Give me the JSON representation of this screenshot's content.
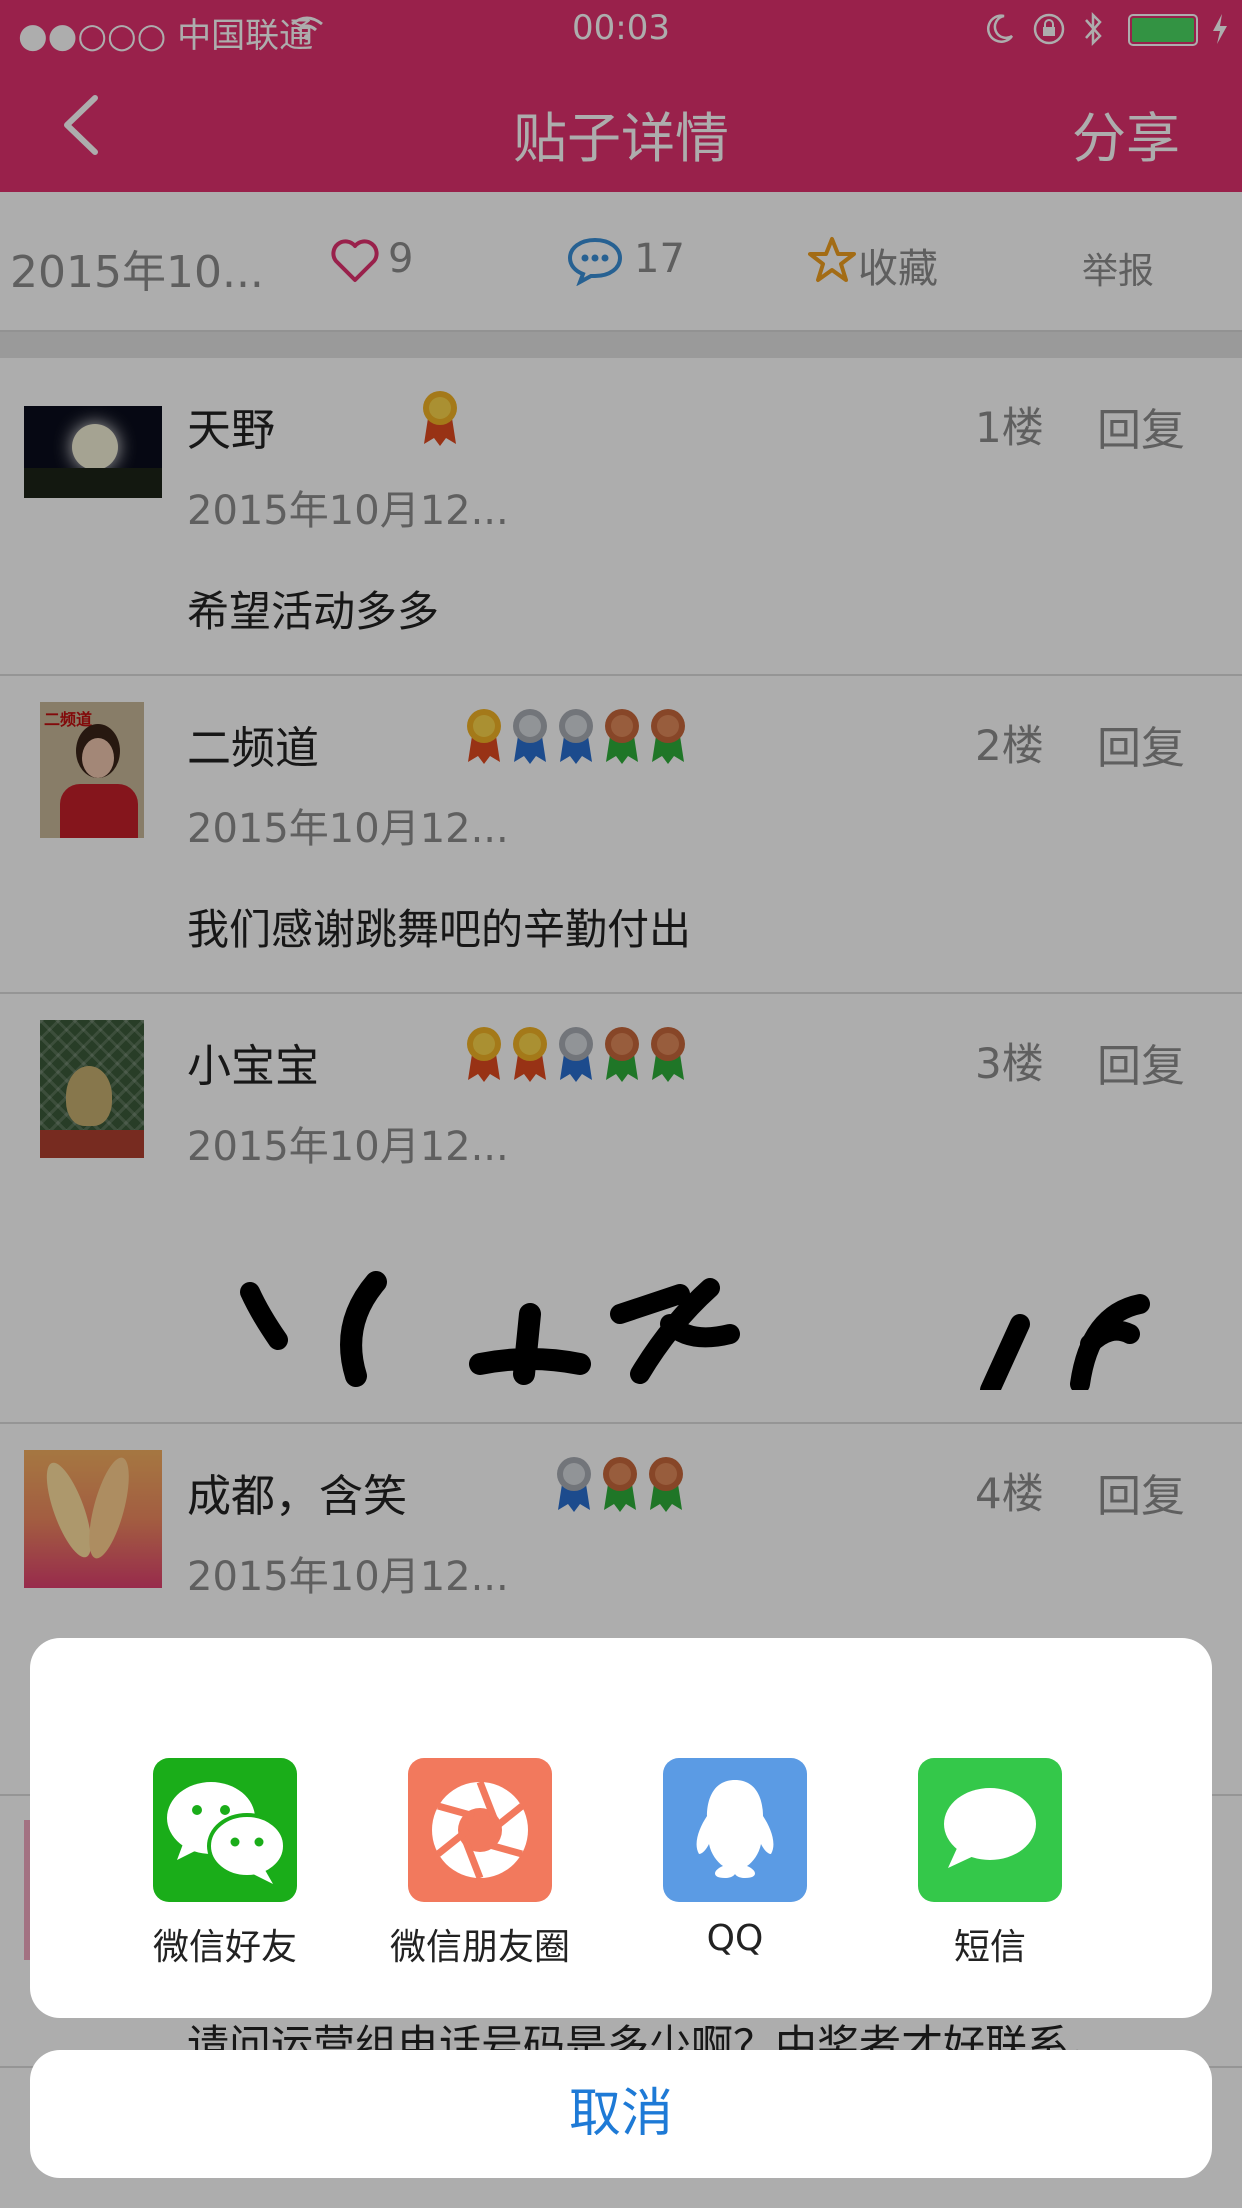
{
  "status_bar": {
    "carrier": "●●○○○ 中国联通",
    "time": "00:03"
  },
  "nav": {
    "title": "贴子详情",
    "share_label": "分享"
  },
  "info_bar": {
    "date": "2015年10...",
    "likes": "9",
    "comments": "17",
    "favorite_label": "收藏",
    "report_label": "举报"
  },
  "posts": [
    {
      "name": "天野",
      "date": "2015年10月12...",
      "floor": "1楼",
      "reply": "回复",
      "content": "希望活动多多",
      "medals": [
        "gold"
      ]
    },
    {
      "name": "二频道",
      "date": "2015年10月12...",
      "floor": "2楼",
      "reply": "回复",
      "content": "我们感谢跳舞吧的辛勤付出",
      "avatar_text": "二频道",
      "medals": [
        "gold",
        "silver",
        "silver",
        "bronze",
        "bronze"
      ]
    },
    {
      "name": "小宝宝",
      "date": "2015年10月12...",
      "floor": "3楼",
      "reply": "回复",
      "content": "",
      "medals": [
        "gold",
        "gold",
        "silver",
        "bronze",
        "bronze"
      ]
    },
    {
      "name": "成都，含笑",
      "date": "2015年10月12...",
      "floor": "4楼",
      "reply": "回复",
      "content": "",
      "medals": [
        "silver",
        "bronze",
        "bronze"
      ]
    }
  ],
  "behind_sheet_text": "请问运营组电话号码是多少啊？中奖者才好联系。",
  "share_sheet": {
    "items": [
      {
        "label": "微信好友",
        "icon": "wechat-icon",
        "color": "#1aad19"
      },
      {
        "label": "微信朋友圈",
        "icon": "moments-icon",
        "color": "#f2795d"
      },
      {
        "label": "QQ",
        "icon": "qq-icon",
        "color": "#5b9be4"
      },
      {
        "label": "短信",
        "icon": "sms-icon",
        "color": "#34c84a"
      }
    ],
    "cancel_label": "取消"
  },
  "colors": {
    "accent": "#e2326f",
    "link": "#1e7ad6"
  }
}
